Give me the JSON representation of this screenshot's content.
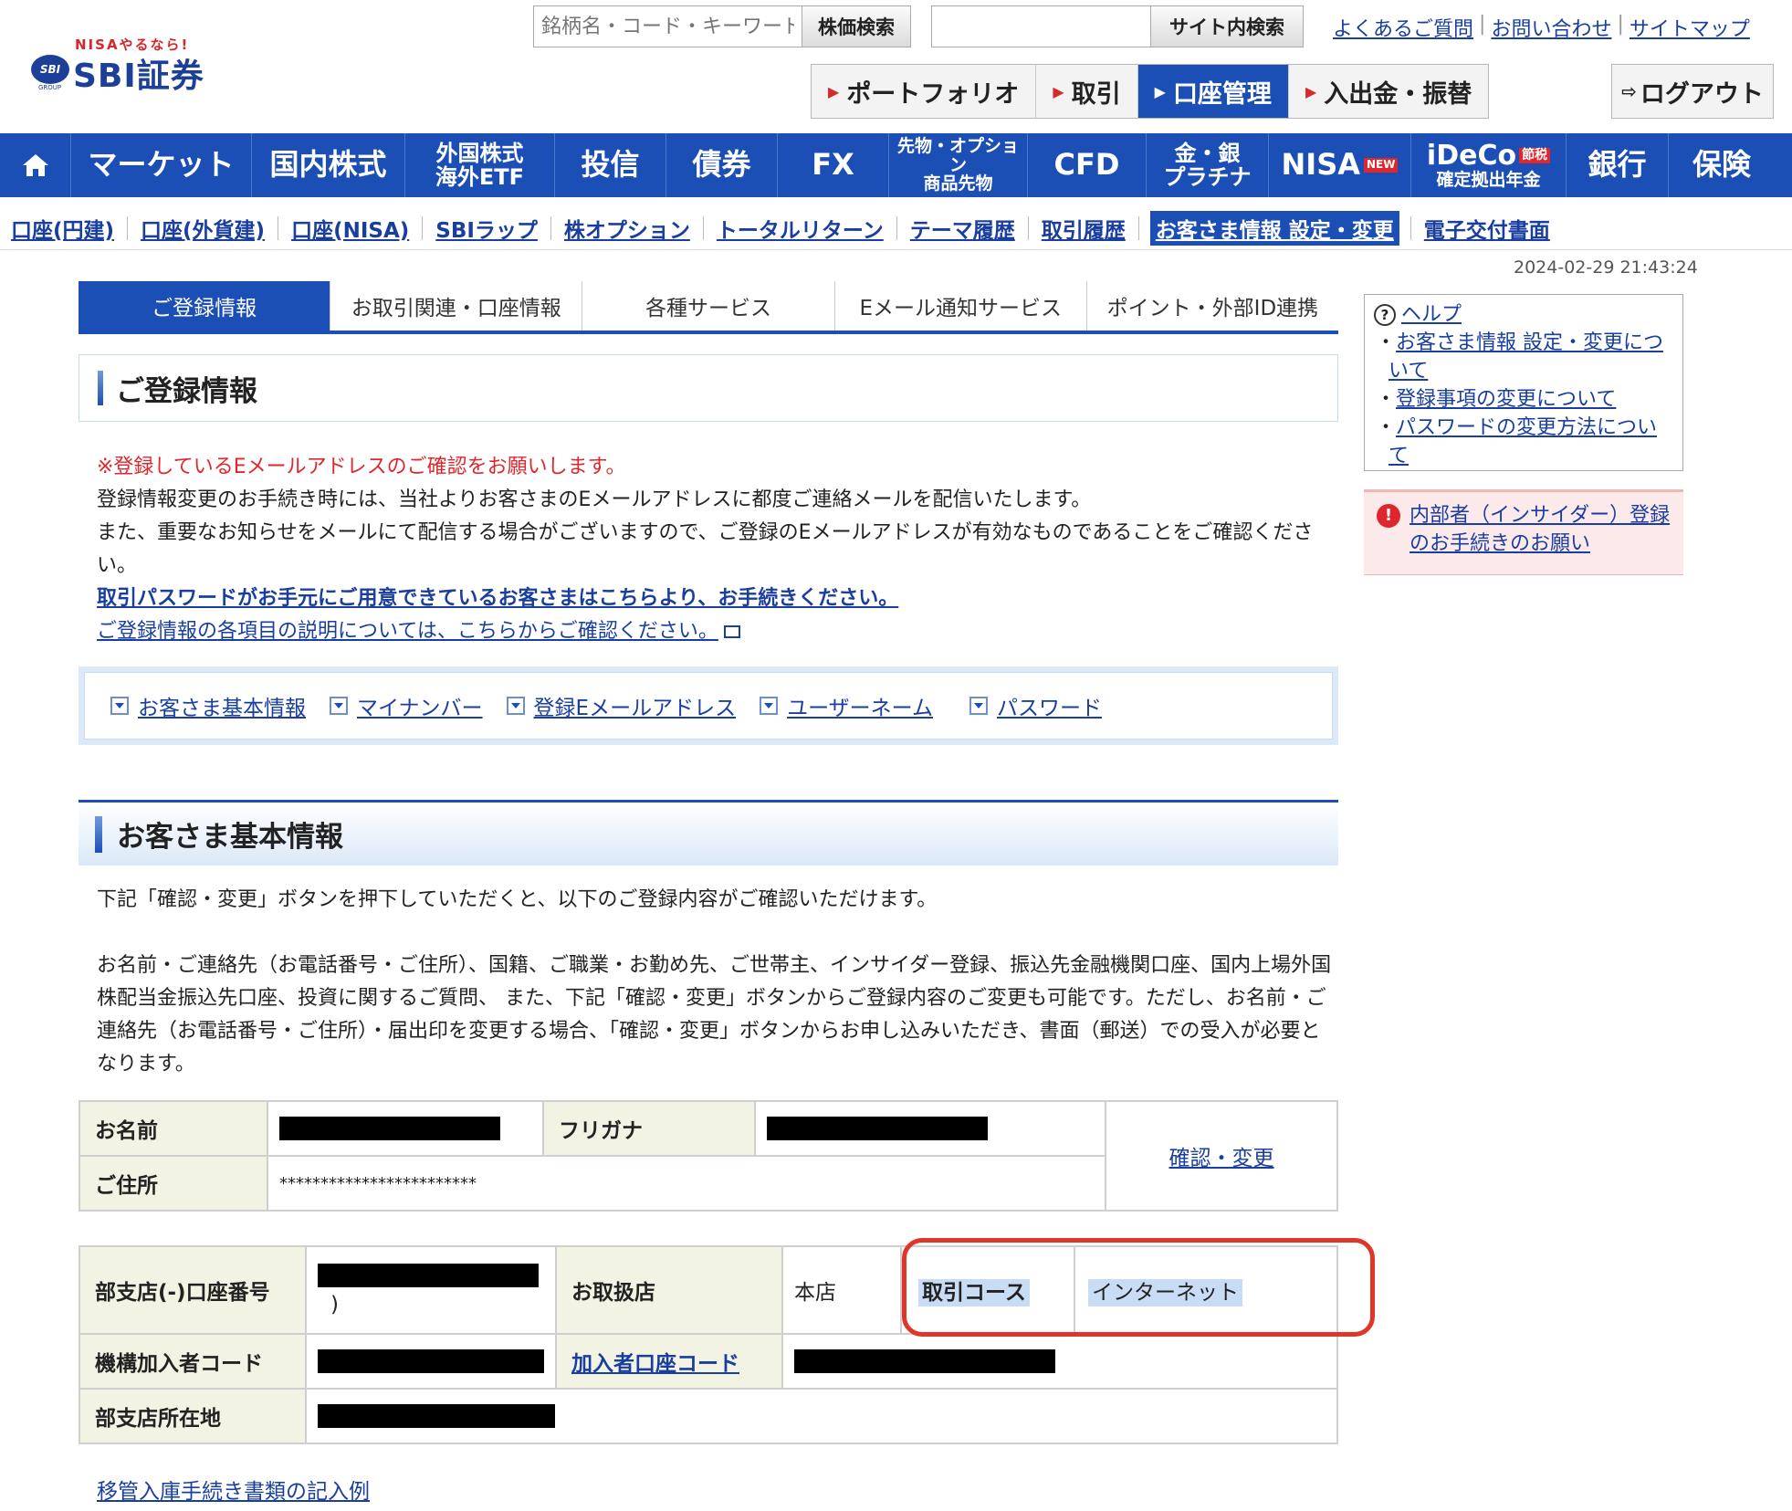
{
  "header": {
    "logo_tag": "NISAやるなら!",
    "logo_badge": "SBI",
    "logo_group": "GROUP",
    "logo_name": "SBI証券",
    "stock_search_placeholder": "銘柄名・コード・キーワード",
    "stock_search_button": "株価検索",
    "site_search_placeholder": "",
    "site_search_button": "サイト内検索",
    "top_links": [
      "よくあるご質問",
      "お問い合わせ",
      "サイトマップ"
    ],
    "main_nav": [
      "ポートフォリオ",
      "取引",
      "口座管理",
      "入出金・振替"
    ],
    "logout": "ログアウト"
  },
  "global_nav": {
    "market": "マーケット",
    "domestic": "国内株式",
    "foreign_l1": "外国株式",
    "foreign_l2": "海外ETF",
    "funds": "投信",
    "bonds": "債券",
    "fx": "FX",
    "futures_l1": "先物・オプション",
    "futures_l2": "商品先物",
    "cfd": "CFD",
    "gold_l1": "金・銀",
    "gold_l2": "プラチナ",
    "nisa": "NISA",
    "nisa_new": "NEW",
    "ideco": "iDeCo",
    "ideco_tag": "節税",
    "ideco_l2": "確定拠出年金",
    "bank": "銀行",
    "insurance": "保険"
  },
  "sub_nav": [
    "口座(円建)",
    "口座(外貨建)",
    "口座(NISA)",
    "SBIラップ",
    "株オプション",
    "トータルリターン",
    "テーマ履歴",
    "取引履歴",
    "お客さま情報 設定・変更",
    "電子交付書面"
  ],
  "timestamp": "2024-02-29 21:43:24",
  "content_tabs": [
    "ご登録情報",
    "お取引関連・口座情報",
    "各種サービス",
    "Eメール通知サービス",
    "ポイント・外部ID連携"
  ],
  "page_title": "ご登録情報",
  "notice": {
    "red": "※登録しているEメールアドレスのご確認をお願いします。",
    "line1": "登録情報変更のお手続き時には、当社よりお客さまのEメールアドレスに都度ご連絡メールを配信いたします。",
    "line2": "また、重要なお知らせをメールにて配信する場合がございますので、ご登録のEメールアドレスが有効なものであることをご確認ください。",
    "link1": "取引パスワードがお手元にご用意できているお客さまはこちらより、お手続きください。",
    "link2": "ご登録情報の各項目の説明については、こちらからご確認ください。"
  },
  "anchors": [
    "お客さま基本情報",
    "マイナンバー",
    "登録Eメールアドレス",
    "ユーザーネーム",
    "パスワード"
  ],
  "section_title": "お客さま基本情報",
  "section_desc": {
    "p1": "下記「確認・変更」ボタンを押下していただくと、以下のご登録内容がご確認いただけます。",
    "p2": "お名前・ご連絡先（お電話番号・ご住所）、国籍、ご職業・お勤め先、ご世帯主、インサイダー登録、振込先金融機関口座、国内上場外国株配当金振込先口座、投資に関するご質問、 また、下記「確認・変更」ボタンからご登録内容のご変更も可能です。ただし、お名前・ご連絡先（お電話番号・ご住所）・届出印を変更する場合、「確認・変更」ボタンからお申し込みいただき、書面（郵送）での受入が必要となります。"
  },
  "table1": {
    "name_label": "お名前",
    "kana_label": "フリガナ",
    "address_label": "ご住所",
    "address_value": "************************",
    "confirm_link": "確認・変更"
  },
  "table2": {
    "account_label": "部支店(-)口座番号",
    "account_suffix": ")",
    "branch_label": "お取扱店",
    "branch_value": "本店",
    "course_label": "取引コース",
    "course_value": "インターネット",
    "member_code_label": "機構加入者コード",
    "member_account_link": "加入者口座コード",
    "branch_address_label": "部支店所在地"
  },
  "bottom_link": "移管入庫手続き書類の記入例",
  "help": {
    "title": "ヘルプ",
    "items": [
      "お客さま情報 設定・変更について",
      "登録事項の変更について",
      "パスワードの変更方法について"
    ]
  },
  "insider_link": "内部者（インサイダー）登録のお手続きのお願い",
  "colors": {
    "brand_blue": "#1c4fb6",
    "alert_red": "#e0262d",
    "highlight_frame": "#e0362a"
  }
}
